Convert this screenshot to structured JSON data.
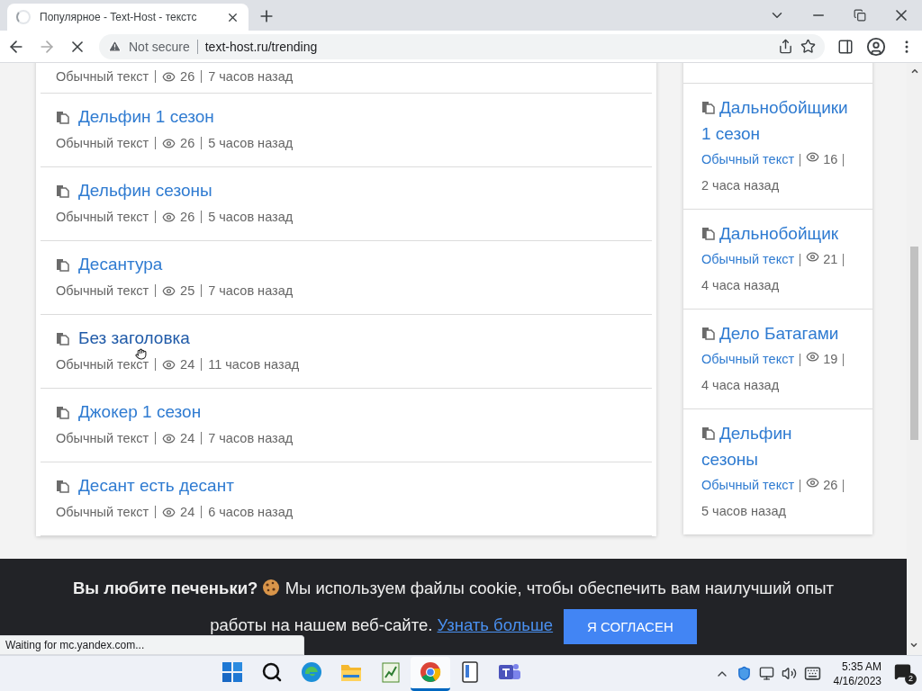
{
  "browser": {
    "tab": {
      "title": "Популярное - Text-Host - текстс",
      "loading": true
    },
    "address": {
      "security": "Not secure",
      "url": "text-host.ru/trending"
    }
  },
  "main_list": {
    "top_partial": {
      "type": "Обычный текст",
      "views": "26",
      "time": "7 часов назад"
    },
    "items": [
      {
        "title": "Дельфин 1 сезон",
        "type": "Обычный текст",
        "views": "26",
        "time": "5 часов назад",
        "hovered": false
      },
      {
        "title": "Дельфин сезоны",
        "type": "Обычный текст",
        "views": "26",
        "time": "5 часов назад",
        "hovered": false
      },
      {
        "title": "Десантура",
        "type": "Обычный текст",
        "views": "25",
        "time": "7 часов назад",
        "hovered": false
      },
      {
        "title": "Без заголовка",
        "type": "Обычный текст",
        "views": "24",
        "time": "11 часов назад",
        "hovered": true
      },
      {
        "title": "Джокер 1 сезон",
        "type": "Обычный текст",
        "views": "24",
        "time": "7 часов назад",
        "hovered": false
      },
      {
        "title": "Десант есть десант",
        "type": "Обычный текст",
        "views": "24",
        "time": "6 часов назад",
        "hovered": false
      }
    ]
  },
  "sidebar": {
    "items": [
      {
        "title": "Дальнобойщики 1 сезон",
        "type": "Обычный текст",
        "views": "16",
        "time": "2 часа назад"
      },
      {
        "title": "Дальнобойщик",
        "type": "Обычный текст",
        "views": "21",
        "time": "4 часа назад"
      },
      {
        "title": "Дело Батагами",
        "type": "Обычный текст",
        "views": "19",
        "time": "4 часа назад"
      },
      {
        "title": "Дельфин сезоны",
        "type": "Обычный текст",
        "views": "26",
        "time": "5 часов назад"
      }
    ]
  },
  "cookie_banner": {
    "heading": "Вы любите печеньки?",
    "message": "Мы используем файлы cookie, чтобы обеспечить вам наилучший опыт работы на нашем веб-сайте.",
    "link": "Узнать больше",
    "button": "Я СОГЛАСЕН"
  },
  "status_bubble": "Waiting for mc.yandex.com...",
  "taskbar": {
    "apps": [
      {
        "kind": "start",
        "active": false
      },
      {
        "kind": "search",
        "active": false
      },
      {
        "kind": "edge",
        "active": false
      },
      {
        "kind": "explorer",
        "active": false
      },
      {
        "kind": "notepad",
        "active": false
      },
      {
        "kind": "chrome",
        "active": true
      },
      {
        "kind": "reader",
        "active": false
      },
      {
        "kind": "teams",
        "active": false
      }
    ],
    "time": "5:35 AM",
    "date": "4/16/2023",
    "notifications": "2"
  }
}
